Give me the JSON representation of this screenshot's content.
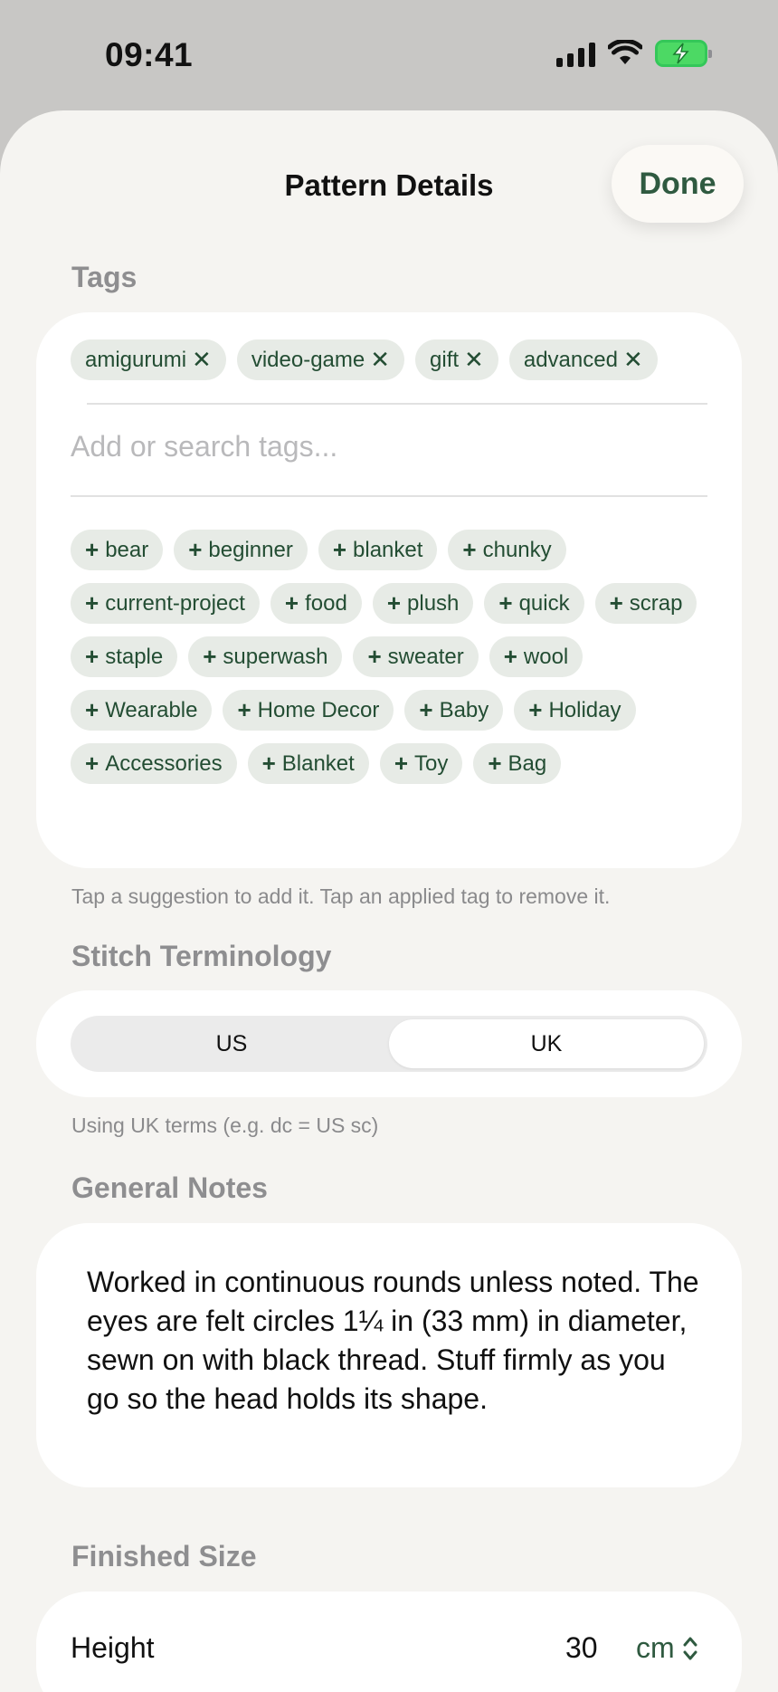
{
  "status_bar": {
    "time": "09:41"
  },
  "header": {
    "title": "Pattern Details",
    "done_label": "Done"
  },
  "tags": {
    "section_title": "Tags",
    "applied": [
      "amigurumi",
      "video-game",
      "gift",
      "advanced"
    ],
    "remove_glyph": "✕",
    "add_glyph": "+",
    "input_placeholder": "Add or search tags...",
    "suggestions": [
      "bear",
      "beginner",
      "blanket",
      "chunky",
      "current-project",
      "food",
      "plush",
      "quick",
      "scrap",
      "staple",
      "superwash",
      "sweater",
      "wool",
      "Wearable",
      "Home Decor",
      "Baby",
      "Holiday",
      "Accessories",
      "Blanket",
      "Toy",
      "Bag"
    ],
    "helper": "Tap a suggestion to add it. Tap an applied tag to remove it."
  },
  "terminology": {
    "section_title": "Stitch Terminology",
    "options": [
      "US",
      "UK"
    ],
    "selected": "UK",
    "helper": "Using UK terms (e.g. dc = US sc)"
  },
  "notes": {
    "section_title": "General Notes",
    "text": "Worked in continuous rounds unless noted. The eyes are felt circles 1¼ in (33 mm) in diameter, sewn on with black thread. Stuff firmly as you go so the head holds its shape."
  },
  "finished_size": {
    "section_title": "Finished Size",
    "height_label": "Height",
    "height_value": "30",
    "height_unit": "cm"
  },
  "colors": {
    "accent": "#2f5a40",
    "chip_bg": "#e7ebe6",
    "sheet_bg": "#f5f4f1"
  }
}
